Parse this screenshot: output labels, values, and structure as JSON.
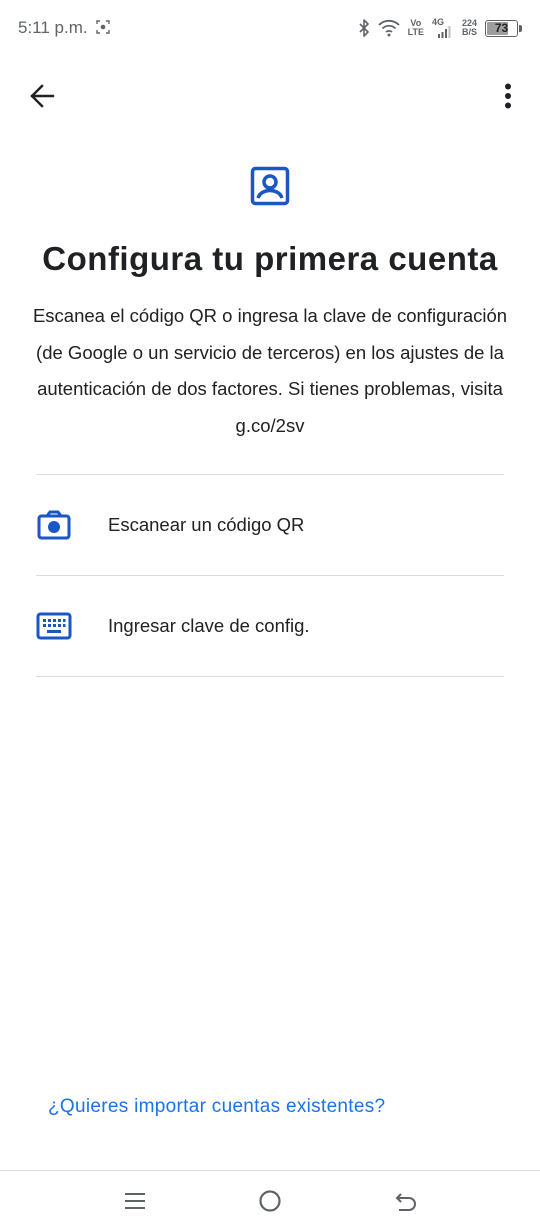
{
  "status_bar": {
    "time": "5:11 p.m.",
    "volte_top": "Vo",
    "volte_bottom": "LTE",
    "network": "4G",
    "speed_value": "224",
    "speed_unit": "B/S",
    "battery": "73",
    "battery_level_percent": 73
  },
  "app_bar": {
    "back_icon": "arrow-left-icon",
    "menu_icon": "more-vert-icon"
  },
  "header": {
    "icon": "account-box-icon",
    "title": "Configura tu primera cuenta",
    "description": "Escanea el código QR o ingresa la clave de configuración (de Google o un servicio de terceros) en los ajustes de la autenticación de dos factores. Si tienes problemas, visita g.co/2sv"
  },
  "options": [
    {
      "icon": "camera-icon",
      "label": "Escanear un código QR"
    },
    {
      "icon": "keyboard-icon",
      "label": "Ingresar clave de config."
    }
  ],
  "footer": {
    "import_link": "¿Quieres importar cuentas existentes?"
  },
  "colors": {
    "accent": "#1a73e8",
    "icon_blue": "#1a56c4",
    "text": "#202124",
    "divider": "#dadce0"
  },
  "nav_bar": {
    "menu_icon": "menu-icon",
    "home_icon": "home-circle-icon",
    "back_icon": "nav-back-icon"
  }
}
